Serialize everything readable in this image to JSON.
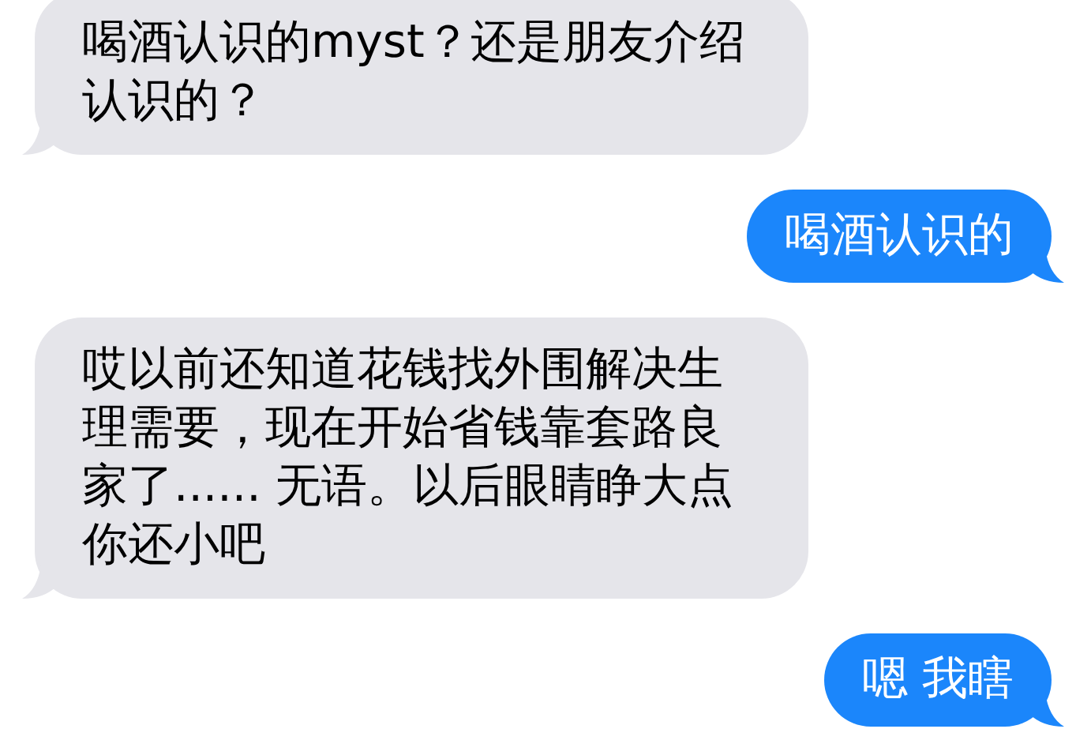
{
  "messages": [
    {
      "kind": "received",
      "text": "喝酒认识的myst？还是朋友介绍认识的？"
    },
    {
      "kind": "sent",
      "text": "喝酒认识的"
    },
    {
      "kind": "received",
      "text": "哎以前还知道花钱找外围解决生理需要，现在开始省钱靠套路良家了...... 无语。以后眼睛睁大点你还小吧"
    },
    {
      "kind": "sent",
      "text": "嗯 我瞎"
    }
  ]
}
